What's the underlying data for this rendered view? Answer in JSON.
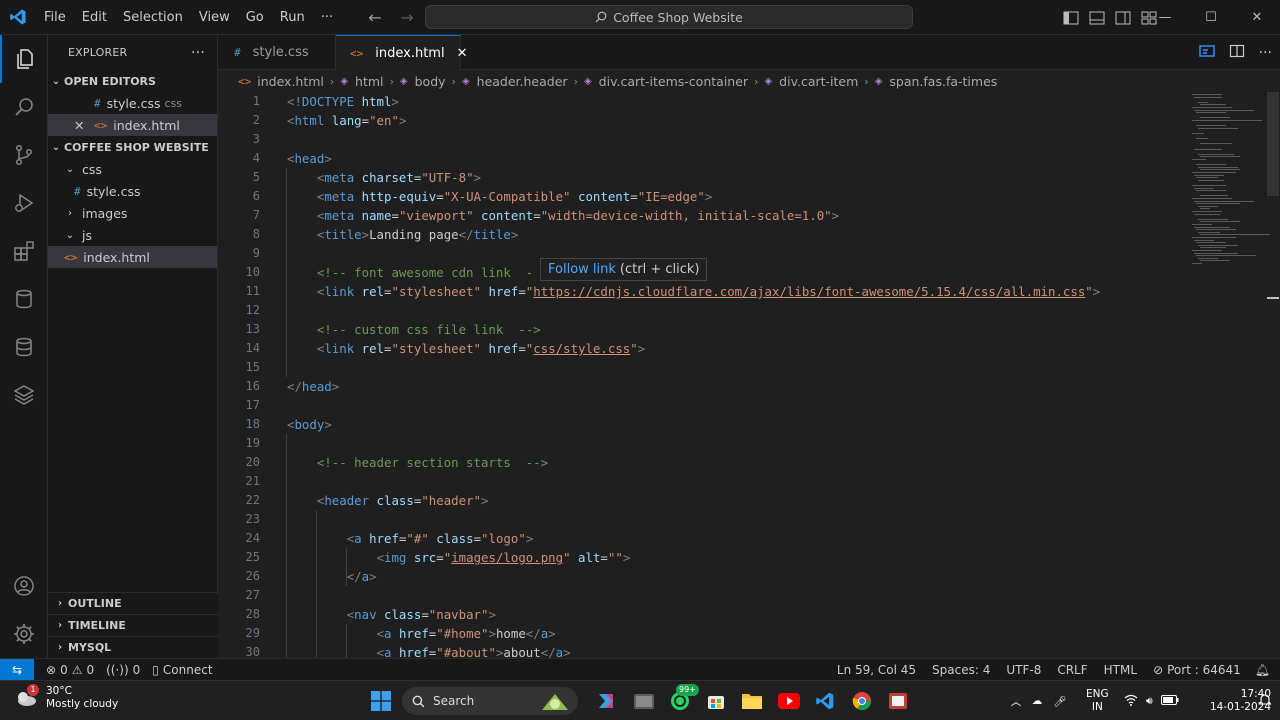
{
  "titlebar": {
    "menu": [
      "File",
      "Edit",
      "Selection",
      "View",
      "Go",
      "Run",
      "···"
    ],
    "search_text": "Coffee Shop Website"
  },
  "sidebar": {
    "title": "EXPLORER",
    "more": "···",
    "open_editors_label": "OPEN EDITORS",
    "open_editors": [
      {
        "name": "style.css",
        "folder": "css"
      },
      {
        "name": "index.html",
        "folder": ""
      }
    ],
    "workspace_label": "COFFEE SHOP WEBSITE",
    "tree": [
      "css",
      "style.css",
      "images",
      "js",
      "index.html"
    ],
    "sections": [
      "OUTLINE",
      "TIMELINE",
      "MYSQL"
    ]
  },
  "tabs": [
    {
      "label": "style.css"
    },
    {
      "label": "index.html"
    }
  ],
  "breadcrumb": [
    "index.html",
    "html",
    "body",
    "header.header",
    "div.cart-items-container",
    "div.cart-item",
    "span.fas.fa-times"
  ],
  "editor": {
    "line_numbers": [
      "1",
      "2",
      "3",
      "4",
      "5",
      "6",
      "7",
      "8",
      "9",
      "10",
      "11",
      "12",
      "13",
      "14",
      "15",
      "16",
      "17",
      "18",
      "19",
      "20",
      "21",
      "22",
      "23",
      "24",
      "25",
      "26",
      "27",
      "28",
      "29",
      "30"
    ],
    "lines": [
      [
        {
          "t": "br",
          "v": "<!"
        },
        {
          "t": "tag",
          "v": "DOCTYPE"
        },
        {
          "t": "txt",
          "v": " "
        },
        {
          "t": "attr",
          "v": "html"
        },
        {
          "t": "br",
          "v": ">"
        }
      ],
      [
        {
          "t": "br",
          "v": "<"
        },
        {
          "t": "tag",
          "v": "html"
        },
        {
          "t": "txt",
          "v": " "
        },
        {
          "t": "attr",
          "v": "lang"
        },
        {
          "t": "txt",
          "v": "="
        },
        {
          "t": "str",
          "v": "\"en\""
        },
        {
          "t": "br",
          "v": ">"
        }
      ],
      [],
      [
        {
          "t": "br",
          "v": "<"
        },
        {
          "t": "tag",
          "v": "head"
        },
        {
          "t": "br",
          "v": ">"
        }
      ],
      [
        {
          "t": "txt",
          "v": "    "
        },
        {
          "t": "br",
          "v": "<"
        },
        {
          "t": "tag",
          "v": "meta"
        },
        {
          "t": "txt",
          "v": " "
        },
        {
          "t": "attr",
          "v": "charset"
        },
        {
          "t": "txt",
          "v": "="
        },
        {
          "t": "str",
          "v": "\"UTF-8\""
        },
        {
          "t": "br",
          "v": ">"
        }
      ],
      [
        {
          "t": "txt",
          "v": "    "
        },
        {
          "t": "br",
          "v": "<"
        },
        {
          "t": "tag",
          "v": "meta"
        },
        {
          "t": "txt",
          "v": " "
        },
        {
          "t": "attr",
          "v": "http-equiv"
        },
        {
          "t": "txt",
          "v": "="
        },
        {
          "t": "str",
          "v": "\"X-UA-Compatible\""
        },
        {
          "t": "txt",
          "v": " "
        },
        {
          "t": "attr",
          "v": "content"
        },
        {
          "t": "txt",
          "v": "="
        },
        {
          "t": "str",
          "v": "\"IE=edge\""
        },
        {
          "t": "br",
          "v": ">"
        }
      ],
      [
        {
          "t": "txt",
          "v": "    "
        },
        {
          "t": "br",
          "v": "<"
        },
        {
          "t": "tag",
          "v": "meta"
        },
        {
          "t": "txt",
          "v": " "
        },
        {
          "t": "attr",
          "v": "name"
        },
        {
          "t": "txt",
          "v": "="
        },
        {
          "t": "str",
          "v": "\"viewport\""
        },
        {
          "t": "txt",
          "v": " "
        },
        {
          "t": "attr",
          "v": "content"
        },
        {
          "t": "txt",
          "v": "="
        },
        {
          "t": "str",
          "v": "\"width=device-width, initial-scale=1.0\""
        },
        {
          "t": "br",
          "v": ">"
        }
      ],
      [
        {
          "t": "txt",
          "v": "    "
        },
        {
          "t": "br",
          "v": "<"
        },
        {
          "t": "tag",
          "v": "title"
        },
        {
          "t": "br",
          "v": ">"
        },
        {
          "t": "txt",
          "v": "Landing page"
        },
        {
          "t": "br",
          "v": "</"
        },
        {
          "t": "tag",
          "v": "title"
        },
        {
          "t": "br",
          "v": ">"
        }
      ],
      [],
      [
        {
          "t": "txt",
          "v": "    "
        },
        {
          "t": "cmt",
          "v": "<!-- font awesome cdn link  -"
        }
      ],
      [
        {
          "t": "txt",
          "v": "    "
        },
        {
          "t": "br",
          "v": "<"
        },
        {
          "t": "tag",
          "v": "link"
        },
        {
          "t": "txt",
          "v": " "
        },
        {
          "t": "attr",
          "v": "rel"
        },
        {
          "t": "txt",
          "v": "="
        },
        {
          "t": "str",
          "v": "\"stylesheet\""
        },
        {
          "t": "txt",
          "v": " "
        },
        {
          "t": "attr",
          "v": "href"
        },
        {
          "t": "txt",
          "v": "="
        },
        {
          "t": "str",
          "v": "\""
        },
        {
          "t": "strlink",
          "v": "https://cdnjs.cloudflare.com/ajax/libs/font-awesome/5.15.4/css/all.min.css"
        },
        {
          "t": "str",
          "v": "\""
        },
        {
          "t": "br",
          "v": ">"
        }
      ],
      [],
      [
        {
          "t": "txt",
          "v": "    "
        },
        {
          "t": "cmt",
          "v": "<!-- custom css file link  -->"
        }
      ],
      [
        {
          "t": "txt",
          "v": "    "
        },
        {
          "t": "br",
          "v": "<"
        },
        {
          "t": "tag",
          "v": "link"
        },
        {
          "t": "txt",
          "v": " "
        },
        {
          "t": "attr",
          "v": "rel"
        },
        {
          "t": "txt",
          "v": "="
        },
        {
          "t": "str",
          "v": "\"stylesheet\""
        },
        {
          "t": "txt",
          "v": " "
        },
        {
          "t": "attr",
          "v": "href"
        },
        {
          "t": "txt",
          "v": "="
        },
        {
          "t": "str",
          "v": "\""
        },
        {
          "t": "strlink",
          "v": "css/style.css"
        },
        {
          "t": "str",
          "v": "\""
        },
        {
          "t": "br",
          "v": ">"
        }
      ],
      [],
      [
        {
          "t": "br",
          "v": "</"
        },
        {
          "t": "tag",
          "v": "head"
        },
        {
          "t": "br",
          "v": ">"
        }
      ],
      [],
      [
        {
          "t": "br",
          "v": "<"
        },
        {
          "t": "tag",
          "v": "body"
        },
        {
          "t": "br",
          "v": ">"
        }
      ],
      [],
      [
        {
          "t": "txt",
          "v": "    "
        },
        {
          "t": "cmt",
          "v": "<!-- header section starts  -->"
        }
      ],
      [],
      [
        {
          "t": "txt",
          "v": "    "
        },
        {
          "t": "br",
          "v": "<"
        },
        {
          "t": "tag",
          "v": "header"
        },
        {
          "t": "txt",
          "v": " "
        },
        {
          "t": "attr",
          "v": "class"
        },
        {
          "t": "txt",
          "v": "="
        },
        {
          "t": "str",
          "v": "\"header\""
        },
        {
          "t": "br",
          "v": ">"
        }
      ],
      [],
      [
        {
          "t": "txt",
          "v": "        "
        },
        {
          "t": "br",
          "v": "<"
        },
        {
          "t": "tag",
          "v": "a"
        },
        {
          "t": "txt",
          "v": " "
        },
        {
          "t": "attr",
          "v": "href"
        },
        {
          "t": "txt",
          "v": "="
        },
        {
          "t": "str",
          "v": "\"#\""
        },
        {
          "t": "txt",
          "v": " "
        },
        {
          "t": "attr",
          "v": "class"
        },
        {
          "t": "txt",
          "v": "="
        },
        {
          "t": "str",
          "v": "\"logo\""
        },
        {
          "t": "br",
          "v": ">"
        }
      ],
      [
        {
          "t": "txt",
          "v": "            "
        },
        {
          "t": "br",
          "v": "<"
        },
        {
          "t": "tag",
          "v": "img"
        },
        {
          "t": "txt",
          "v": " "
        },
        {
          "t": "attr",
          "v": "src"
        },
        {
          "t": "txt",
          "v": "="
        },
        {
          "t": "str",
          "v": "\""
        },
        {
          "t": "strlink",
          "v": "images/logo.png"
        },
        {
          "t": "str",
          "v": "\""
        },
        {
          "t": "txt",
          "v": " "
        },
        {
          "t": "attr",
          "v": "alt"
        },
        {
          "t": "txt",
          "v": "="
        },
        {
          "t": "str",
          "v": "\"\""
        },
        {
          "t": "br",
          "v": ">"
        }
      ],
      [
        {
          "t": "txt",
          "v": "        "
        },
        {
          "t": "br",
          "v": "</"
        },
        {
          "t": "tag",
          "v": "a"
        },
        {
          "t": "br",
          "v": ">"
        }
      ],
      [],
      [
        {
          "t": "txt",
          "v": "        "
        },
        {
          "t": "br",
          "v": "<"
        },
        {
          "t": "tag",
          "v": "nav"
        },
        {
          "t": "txt",
          "v": " "
        },
        {
          "t": "attr",
          "v": "class"
        },
        {
          "t": "txt",
          "v": "="
        },
        {
          "t": "str",
          "v": "\"navbar\""
        },
        {
          "t": "br",
          "v": ">"
        }
      ],
      [
        {
          "t": "txt",
          "v": "            "
        },
        {
          "t": "br",
          "v": "<"
        },
        {
          "t": "tag",
          "v": "a"
        },
        {
          "t": "txt",
          "v": " "
        },
        {
          "t": "attr",
          "v": "href"
        },
        {
          "t": "txt",
          "v": "="
        },
        {
          "t": "str",
          "v": "\"#home\""
        },
        {
          "t": "br",
          "v": ">"
        },
        {
          "t": "txt",
          "v": "home"
        },
        {
          "t": "br",
          "v": "</"
        },
        {
          "t": "tag",
          "v": "a"
        },
        {
          "t": "br",
          "v": ">"
        }
      ],
      [
        {
          "t": "txt",
          "v": "            "
        },
        {
          "t": "br",
          "v": "<"
        },
        {
          "t": "tag",
          "v": "a"
        },
        {
          "t": "txt",
          "v": " "
        },
        {
          "t": "attr",
          "v": "href"
        },
        {
          "t": "txt",
          "v": "="
        },
        {
          "t": "str",
          "v": "\"#about\""
        },
        {
          "t": "br",
          "v": ">"
        },
        {
          "t": "txt",
          "v": "about"
        },
        {
          "t": "br",
          "v": "</"
        },
        {
          "t": "tag",
          "v": "a"
        },
        {
          "t": "br",
          "v": ">"
        }
      ]
    ],
    "hover_link": "Follow link",
    "hover_hint": "(ctrl + click)"
  },
  "statusbar": {
    "errors": "0",
    "warnings": "0",
    "ports_count": "0",
    "connect": "Connect",
    "position": "Ln 59, Col 45",
    "spaces": "Spaces: 4",
    "encoding": "UTF-8",
    "eol": "CRLF",
    "language": "HTML",
    "port": "Port : 64641"
  },
  "taskbar": {
    "weather_badge": "1",
    "temperature": "30°C",
    "condition": "Mostly cloudy",
    "search": "Search",
    "whatsapp_badge": "99+",
    "lang_top": "ENG",
    "lang_bottom": "IN",
    "time": "17:40",
    "date": "14-01-2024"
  },
  "colors": {
    "accent": "#0078d4",
    "tag": "#569cd6",
    "attr": "#9cdcfe",
    "string": "#ce9178",
    "comment": "#6a9955"
  }
}
